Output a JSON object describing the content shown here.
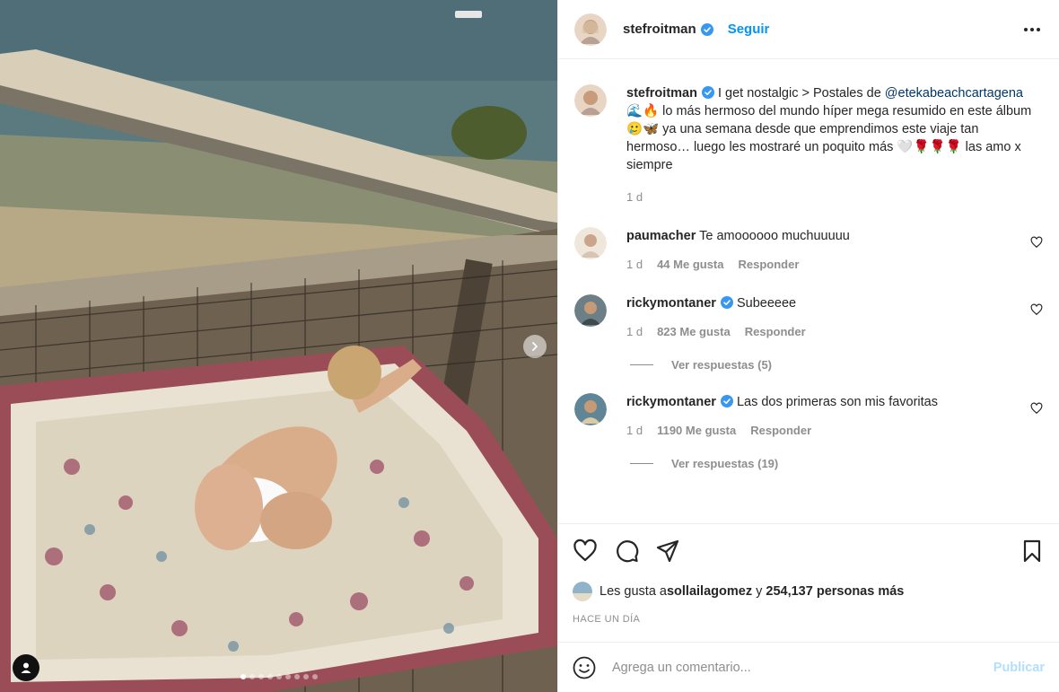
{
  "post": {
    "username": "stefroitman",
    "follow_label": "Seguir",
    "caption": {
      "username": "stefroitman",
      "text_before": " I get nostalgic > Postales de ",
      "mention": "@etekabeachcartagena",
      "text_after": " 🌊🔥 lo más hermoso del mundo híper mega resumido en este álbum 🥲🦋 ya una semana desde que emprendimos este viaje tan hermoso… luego les mostraré un poquito más 🤍🌹🌹🌹 las amo x siempre",
      "time": "1 d"
    }
  },
  "comments": [
    {
      "username": "paumacher",
      "text": " Te amoooooo muchuuuuu",
      "time": "1 d",
      "likes": "44 Me gusta",
      "reply": "Responder",
      "verified": false
    },
    {
      "username": "rickymontaner",
      "text": " Subeeeee",
      "time": "1 d",
      "likes": "823 Me gusta",
      "reply": "Responder",
      "verified": true,
      "view_replies": "Ver respuestas (5)"
    },
    {
      "username": "rickymontaner",
      "text": " Las dos primeras son mis favoritas",
      "time": "1 d",
      "likes": "1190 Me gusta",
      "reply": "Responder",
      "verified": true,
      "view_replies": "Ver respuestas (19)"
    }
  ],
  "likes": {
    "prefix": "Les gusta a ",
    "user": "sollailagomez",
    "mid": " y ",
    "count": "254,137 personas más"
  },
  "timestamp": "HACE UN DÍA",
  "add_comment": {
    "placeholder": "Agrega un comentario...",
    "publish": "Publicar"
  },
  "carousel": {
    "slides": 9,
    "active": 1
  },
  "colors": {
    "accent": "#0095f6",
    "publish_disabled": "#b2dffc",
    "muted": "#8e8e8e"
  },
  "icons": [
    "verified-badge-icon",
    "more-options-icon",
    "heart-icon",
    "comment-icon",
    "share-icon",
    "bookmark-icon",
    "emoji-icon",
    "next-arrow-icon",
    "tag-user-icon"
  ]
}
